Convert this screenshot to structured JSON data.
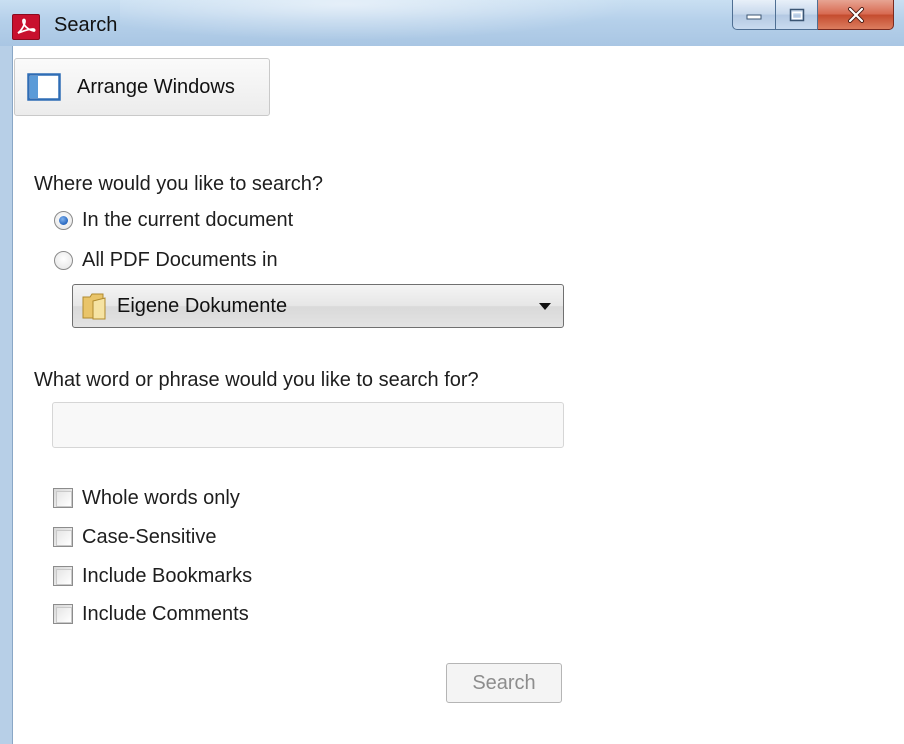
{
  "window": {
    "title": "Search",
    "icons": {
      "app": "acrobat-icon",
      "minimize": "minimize-icon",
      "maximize": "maximize-icon",
      "close": "close-icon"
    }
  },
  "toolbar": {
    "arrange_label": "Arrange Windows",
    "arrange_icon": "arrange-windows-icon"
  },
  "location": {
    "question": "Where would you like to search?",
    "options": [
      {
        "label": "In the current document",
        "checked": true
      },
      {
        "label": "All PDF Documents in",
        "checked": false
      }
    ],
    "folder": {
      "selected": "Eigene Dokumente",
      "icon": "folder-icon"
    }
  },
  "query": {
    "question": "What word or phrase would you like to search for?",
    "value": "",
    "placeholder": ""
  },
  "options": [
    {
      "label": "Whole words only",
      "checked": false
    },
    {
      "label": "Case-Sensitive",
      "checked": false
    },
    {
      "label": "Include Bookmarks",
      "checked": false
    },
    {
      "label": "Include Comments",
      "checked": false
    }
  ],
  "actions": {
    "search_label": "Search",
    "search_enabled": false
  },
  "colors": {
    "titlebar": "#b5d0ea",
    "close_button": "#c44b2e",
    "acrobat_red": "#c8102e",
    "radio_selected": "#1a5bb8"
  }
}
